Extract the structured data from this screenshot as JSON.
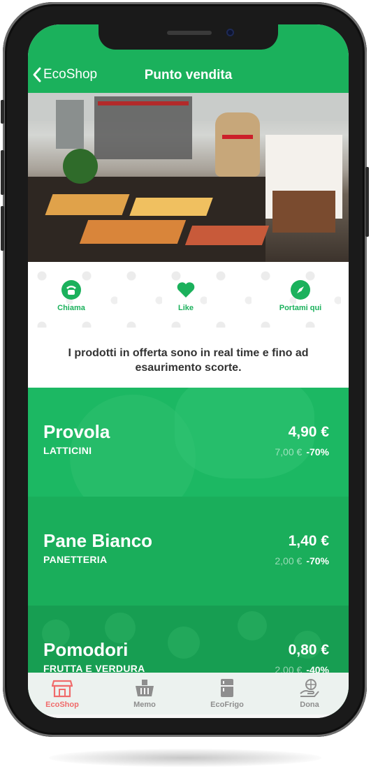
{
  "nav": {
    "back_label": "EcoShop",
    "title": "Punto vendita"
  },
  "actions": [
    {
      "label": "Chiama",
      "icon": "phone-icon"
    },
    {
      "label": "Like",
      "icon": "heart-icon"
    },
    {
      "label": "Portami qui",
      "icon": "compass-icon"
    }
  ],
  "info_text": "I prodotti in offerta sono in real time e fino ad esaurimento scorte.",
  "products": [
    {
      "name": "Provola",
      "category": "LATTICINI",
      "price": "4,90 €",
      "old_price": "7,00 €",
      "discount": "-70%"
    },
    {
      "name": "Pane Bianco",
      "category": "PANETTERIA",
      "price": "1,40 €",
      "old_price": "2,00 €",
      "discount": "-70%"
    },
    {
      "name": "Pomodori",
      "category": "FRUTTA E VERDURA",
      "price": "0,80 €",
      "old_price": "2,00 €",
      "discount": "-40%"
    }
  ],
  "tabs": [
    {
      "label": "EcoShop",
      "icon": "shop-icon",
      "active": true
    },
    {
      "label": "Memo",
      "icon": "basket-icon",
      "active": false
    },
    {
      "label": "EcoFrigo",
      "icon": "fridge-icon",
      "active": false
    },
    {
      "label": "Dona",
      "icon": "donate-icon",
      "active": false
    }
  ],
  "colors": {
    "brand_green": "#1bb15c",
    "active_tab": "#f06b6b",
    "inactive_tab": "#8e8e8e"
  }
}
